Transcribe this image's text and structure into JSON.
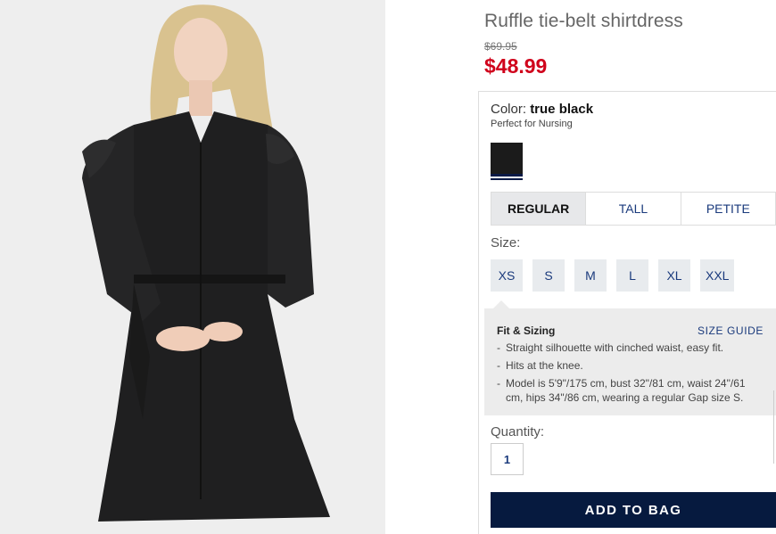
{
  "product": {
    "title": "Ruffle tie-belt shirtdress",
    "original_price": "$69.95",
    "sale_price": "$48.99"
  },
  "color": {
    "label": "Color:",
    "value": "true black",
    "note": "Perfect for Nursing",
    "swatch_color": "#1b1b1b",
    "selected_indicator_color": "#0a1a46"
  },
  "fit_options": [
    {
      "label": "REGULAR",
      "selected": true
    },
    {
      "label": "TALL",
      "selected": false
    },
    {
      "label": "PETITE",
      "selected": false
    }
  ],
  "size": {
    "label": "Size:",
    "options": [
      "XS",
      "S",
      "M",
      "L",
      "XL",
      "XXL"
    ]
  },
  "fit_sizing": {
    "title": "Fit & Sizing",
    "guide_link": "SIZE GUIDE",
    "points": [
      "Straight silhouette with cinched waist, easy fit.",
      "Hits at the knee.",
      "Model is 5'9\"/175 cm, bust 32\"/81 cm, waist 24\"/61 cm, hips 34\"/86 cm, wearing a regular Gap size S."
    ]
  },
  "quantity": {
    "label": "Quantity:",
    "value": "1"
  },
  "cta": {
    "add_to_bag": "ADD TO BAG"
  },
  "colors": {
    "sale_red": "#d0021b",
    "navy": "#061a3f",
    "link_blue": "#1a3a7c"
  }
}
